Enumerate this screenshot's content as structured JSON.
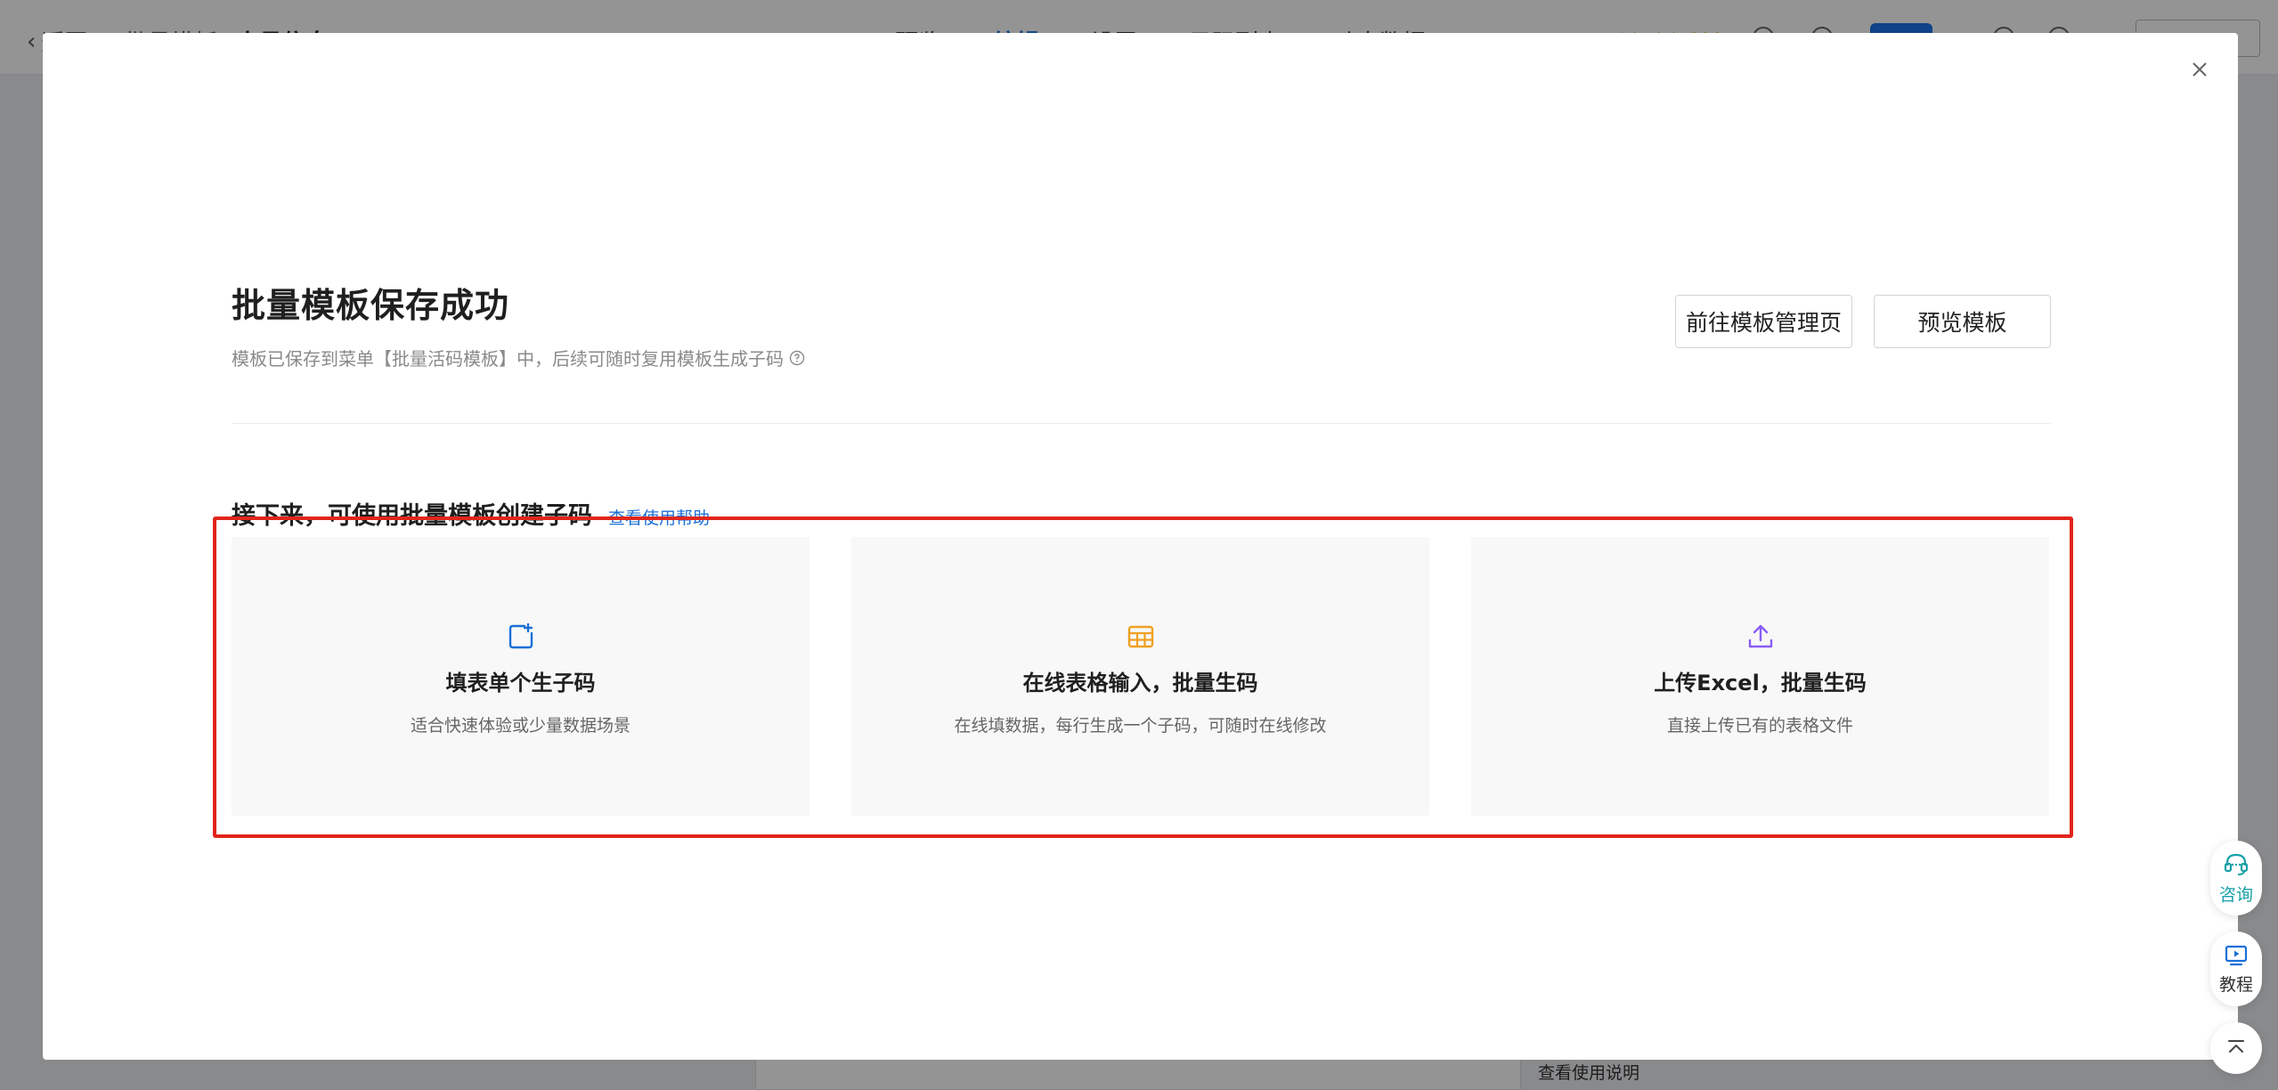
{
  "background": {
    "back_label": "返回",
    "crumb": "批量模板",
    "crumb_current": "人员信息",
    "nav": [
      "预览",
      "编辑",
      "设置",
      "子码列表",
      "动态数据"
    ],
    "promo": "升级高级版享",
    "help_link": "查看使用说明"
  },
  "modal": {
    "title": "批量模板保存成功",
    "subtitle": "模板已保存到菜单【批量活码模板】中，后续可随时复用模板生成子码",
    "manage_button": "前往模板管理页",
    "preview_button": "预览模板",
    "section_title": "接下来，可使用批量模板创建子码",
    "section_link": "查看使用帮助",
    "cards": [
      {
        "icon": "add-square-icon",
        "title": "填表单个生子码",
        "desc": "适合快速体验或少量数据场景",
        "color": "#1a6fd8"
      },
      {
        "icon": "table-icon",
        "title": "在线表格输入，批量生码",
        "desc": "在线填数据，每行生成一个子码，可随时在线修改",
        "color": "#f0a020"
      },
      {
        "icon": "upload-icon",
        "title": "上传Excel，批量生码",
        "desc": "直接上传已有的表格文件",
        "color": "#8a5cf6"
      }
    ]
  },
  "floating": {
    "consult_label": "咨询",
    "tutorial_label": "教程"
  },
  "colors": {
    "accent": "#1a6fd8",
    "highlight": "#e1251b",
    "consult": "#19a0a8"
  }
}
